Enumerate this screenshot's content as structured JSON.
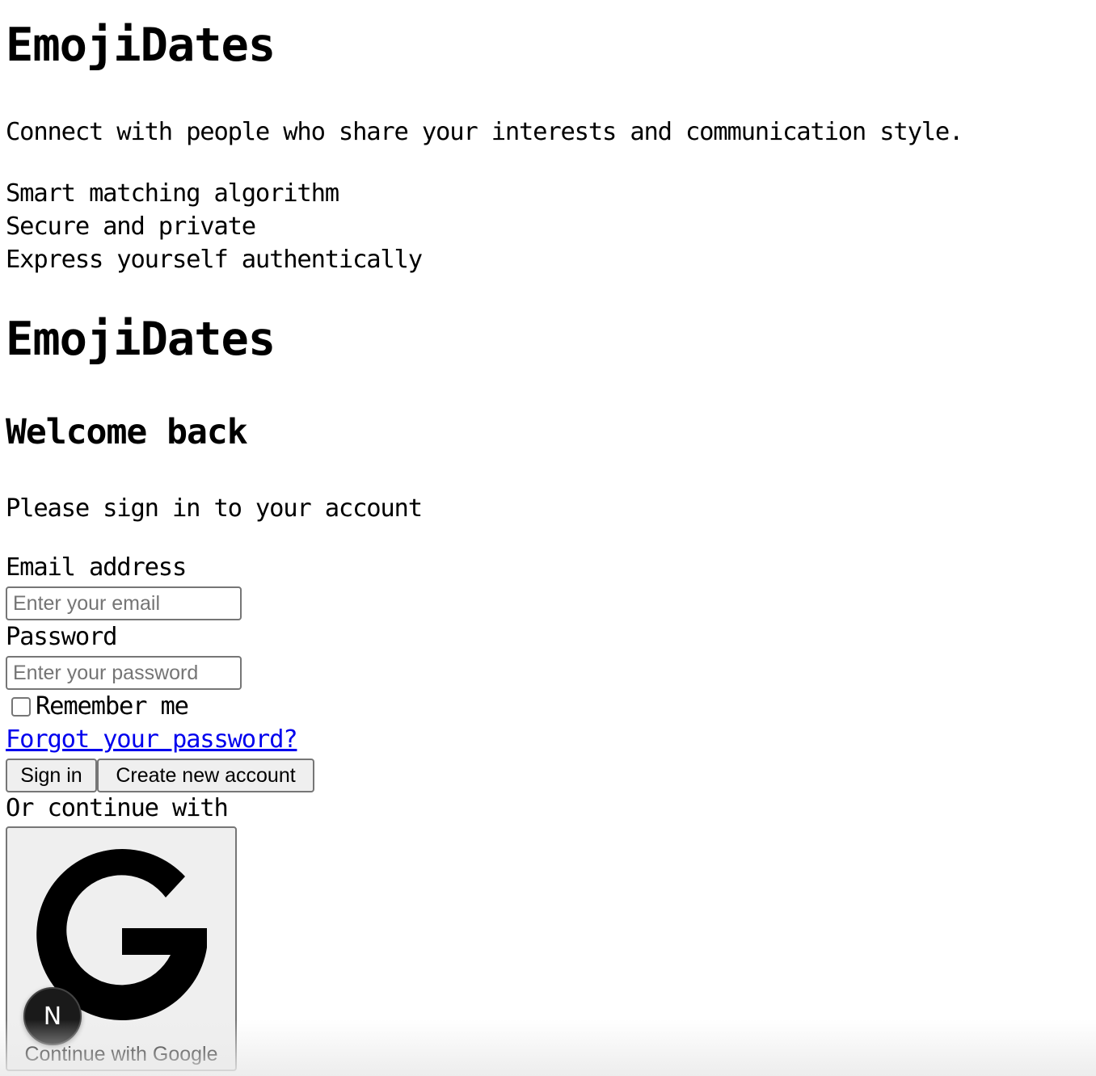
{
  "hero": {
    "title": "EmojiDates",
    "tagline": "Connect with people who share your interests and communication style.",
    "features": [
      "Smart matching algorithm",
      "Secure and private",
      "Express yourself authentically"
    ]
  },
  "login": {
    "brand": "EmojiDates",
    "heading": "Welcome back",
    "subtitle": "Please sign in to your account",
    "email_label": "Email address",
    "email_placeholder": "Enter your email",
    "email_value": "",
    "password_label": "Password",
    "password_placeholder": "Enter your password",
    "password_value": "",
    "remember_label": "Remember me",
    "remember_checked": false,
    "forgot_link": "Forgot your password?",
    "signin_button": "Sign in",
    "create_button": "Create new account",
    "divider_text": "Or continue with",
    "google_button": "Continue with Google"
  },
  "devtools": {
    "badge_letter": "N"
  },
  "colors": {
    "link": "#0000ee",
    "button_bg": "#efefef",
    "border": "#767676"
  }
}
